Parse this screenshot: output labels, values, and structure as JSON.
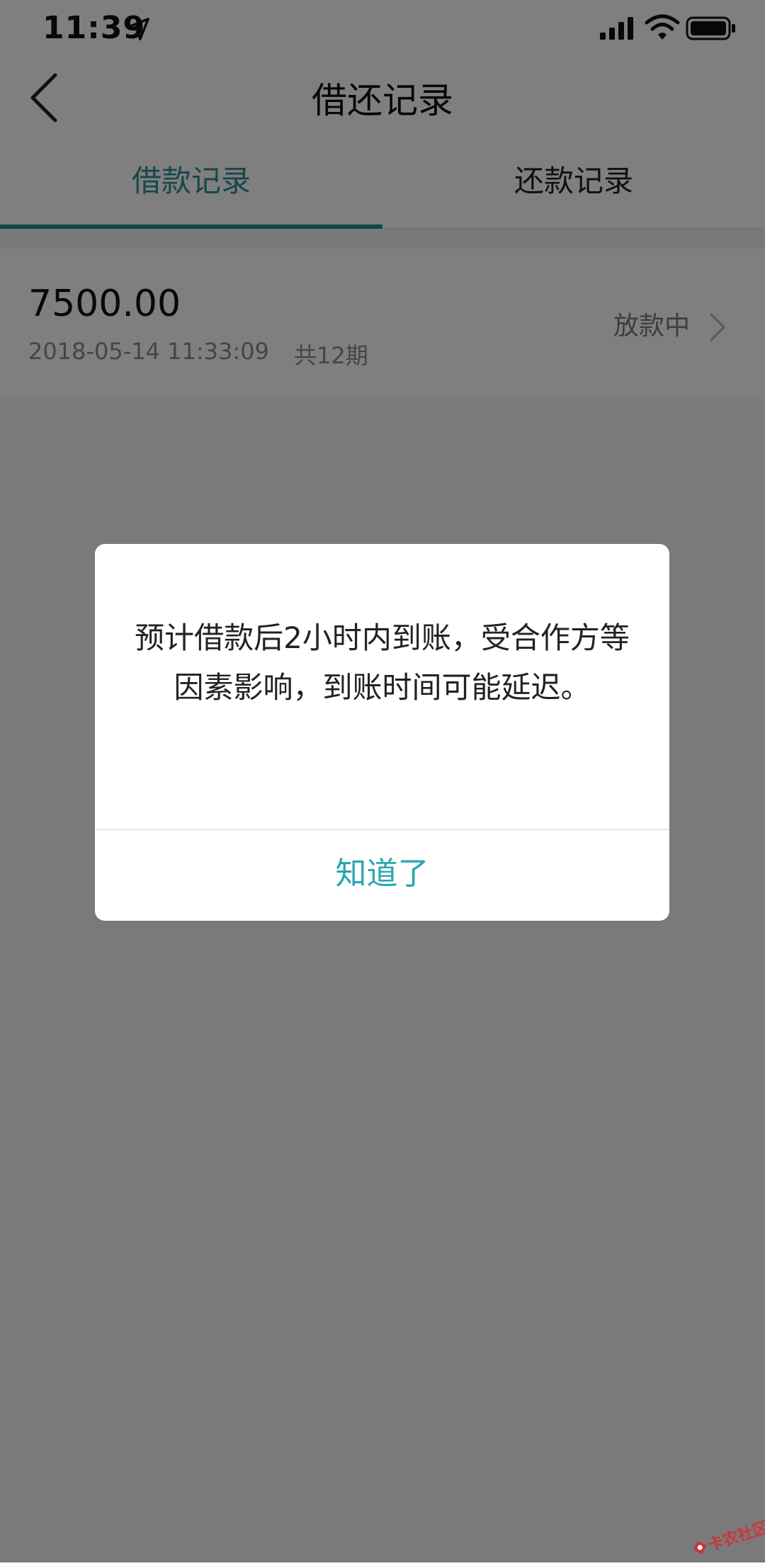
{
  "status_bar": {
    "time": "11:39",
    "icons": [
      "location-arrow-icon",
      "signal-icon",
      "wifi-icon",
      "battery-icon"
    ]
  },
  "nav": {
    "title": "借还记录",
    "back_icon": "chevron-left-icon"
  },
  "tabs": [
    {
      "label": "借款记录",
      "active": true
    },
    {
      "label": "还款记录",
      "active": false
    }
  ],
  "records": [
    {
      "amount": "7500.00",
      "datetime": "2018-05-14 11:33:09",
      "periods": "共12期",
      "status": "放款中"
    }
  ],
  "dialog": {
    "message": "预计借款后2小时内到账，受合作方等因素影响，到账时间可能延迟。",
    "button_label": "知道了"
  },
  "watermark": {
    "text": "卡农社区"
  },
  "colors": {
    "accent": "#2aa6b0",
    "tab_indicator": "#1d8a93",
    "secondary_text": "#8a8a8a",
    "overlay": "rgba(0,0,0,0.5)"
  }
}
